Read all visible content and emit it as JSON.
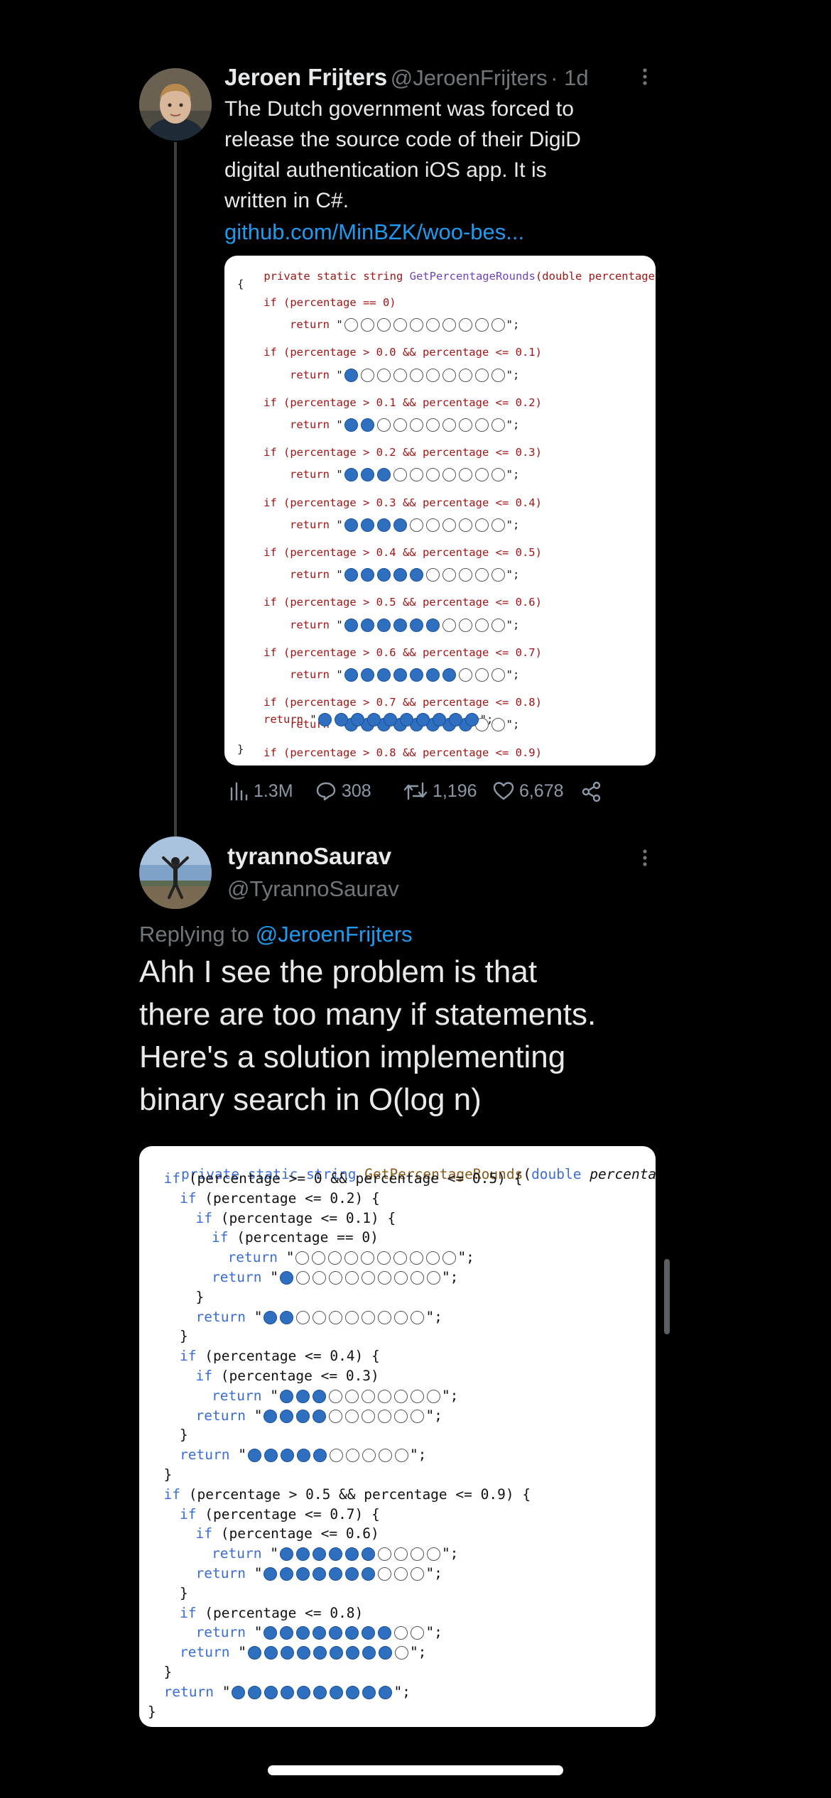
{
  "tweet": {
    "author_name": "Jeroen Frijters",
    "author_handle": "@JeroenFrijters",
    "time": "· 1d",
    "text_lines": [
      "The Dutch government was forced to",
      "release the source code of their DigiD",
      "digital authentication iOS app. It is",
      "written in C#."
    ],
    "link": "github.com/MinBZK/woo-bes...",
    "code": {
      "signature": {
        "kw": "private static string ",
        "fn": "GetPercentageRounds",
        "open": "(",
        "kw2": "double ",
        "param": "percentage",
        "close": ")"
      },
      "open_brace": "{",
      "close_brace": "}",
      "conditions": [
        "if (percentage == 0)",
        "if (percentage > 0.0 && percentage <= 0.1)",
        "if (percentage > 0.1 && percentage <= 0.2)",
        "if (percentage > 0.2 && percentage <= 0.3)",
        "if (percentage > 0.3 && percentage <= 0.4)",
        "if (percentage > 0.4 && percentage <= 0.5)",
        "if (percentage > 0.5 && percentage <= 0.6)",
        "if (percentage > 0.6 && percentage <= 0.7)",
        "if (percentage > 0.7 && percentage <= 0.8)",
        "if (percentage > 0.8 && percentage <= 0.9)"
      ],
      "return_kw": "return",
      "quote_open": "\"",
      "quote_close": "\";",
      "filled_counts": [
        0,
        1,
        2,
        3,
        4,
        5,
        6,
        7,
        8,
        9,
        10
      ]
    },
    "stats": {
      "views": "1.3M",
      "replies": "308",
      "retweets": "1,196",
      "likes": "6,678"
    }
  },
  "reply": {
    "author_name": "tyrannoSaurav",
    "author_handle": "@TyrannoSaurav",
    "replying_label": "Replying to",
    "replying_to": "@JeroenFrijters",
    "text_lines": [
      "Ahh I see the problem is that",
      "there are too many if statements.",
      "Here's a solution implementing",
      "binary search in O(log n)"
    ],
    "code": {
      "signature": {
        "kw": "private static string ",
        "fn": "GetPercentageRounds",
        "open": "(",
        "kw2": "double ",
        "param": "percentage",
        "close": ") {"
      },
      "lines": [
        {
          "indent": 1,
          "text": "if (percentage >= 0 && percentage <= 0.5) {"
        },
        {
          "indent": 2,
          "text": "if (percentage <= 0.2) {"
        },
        {
          "indent": 3,
          "text": "if (percentage <= 0.1) {"
        },
        {
          "indent": 4,
          "text": "if (percentage == 0)"
        },
        {
          "indent": 5,
          "ret": 0
        },
        {
          "indent": 4,
          "ret": 1
        },
        {
          "indent": 3,
          "text": "}"
        },
        {
          "indent": 3,
          "ret": 2
        },
        {
          "indent": 2,
          "text": "}"
        },
        {
          "indent": 2,
          "text": "if (percentage <= 0.4) {"
        },
        {
          "indent": 3,
          "text": "if (percentage <= 0.3)"
        },
        {
          "indent": 4,
          "ret": 3
        },
        {
          "indent": 3,
          "ret": 4
        },
        {
          "indent": 2,
          "text": "}"
        },
        {
          "indent": 2,
          "ret": 5
        },
        {
          "indent": 1,
          "text": "}"
        },
        {
          "indent": 1,
          "text": "if (percentage > 0.5 && percentage <= 0.9) {"
        },
        {
          "indent": 2,
          "text": "if (percentage <= 0.7) {"
        },
        {
          "indent": 3,
          "text": "if (percentage <= 0.6)"
        },
        {
          "indent": 4,
          "ret": 6
        },
        {
          "indent": 3,
          "ret": 7
        },
        {
          "indent": 2,
          "text": "}"
        },
        {
          "indent": 2,
          "text": "if (percentage <= 0.8)"
        },
        {
          "indent": 3,
          "ret": 8
        },
        {
          "indent": 2,
          "ret": 9
        },
        {
          "indent": 1,
          "text": "}"
        },
        {
          "indent": 1,
          "ret": 10
        },
        {
          "indent": 0,
          "text": "}"
        }
      ],
      "return_kw": "return",
      "quote_open": "\"",
      "quote_close": "\";"
    }
  },
  "colors": {
    "background": "#000000",
    "link": "#1d9bf0",
    "dot_fill": "#2f6fc0",
    "dot_fill_dark": "#1a4f97"
  },
  "icons": [
    "views-icon",
    "reply-icon",
    "retweet-icon",
    "like-icon",
    "share-icon",
    "more-icon"
  ]
}
